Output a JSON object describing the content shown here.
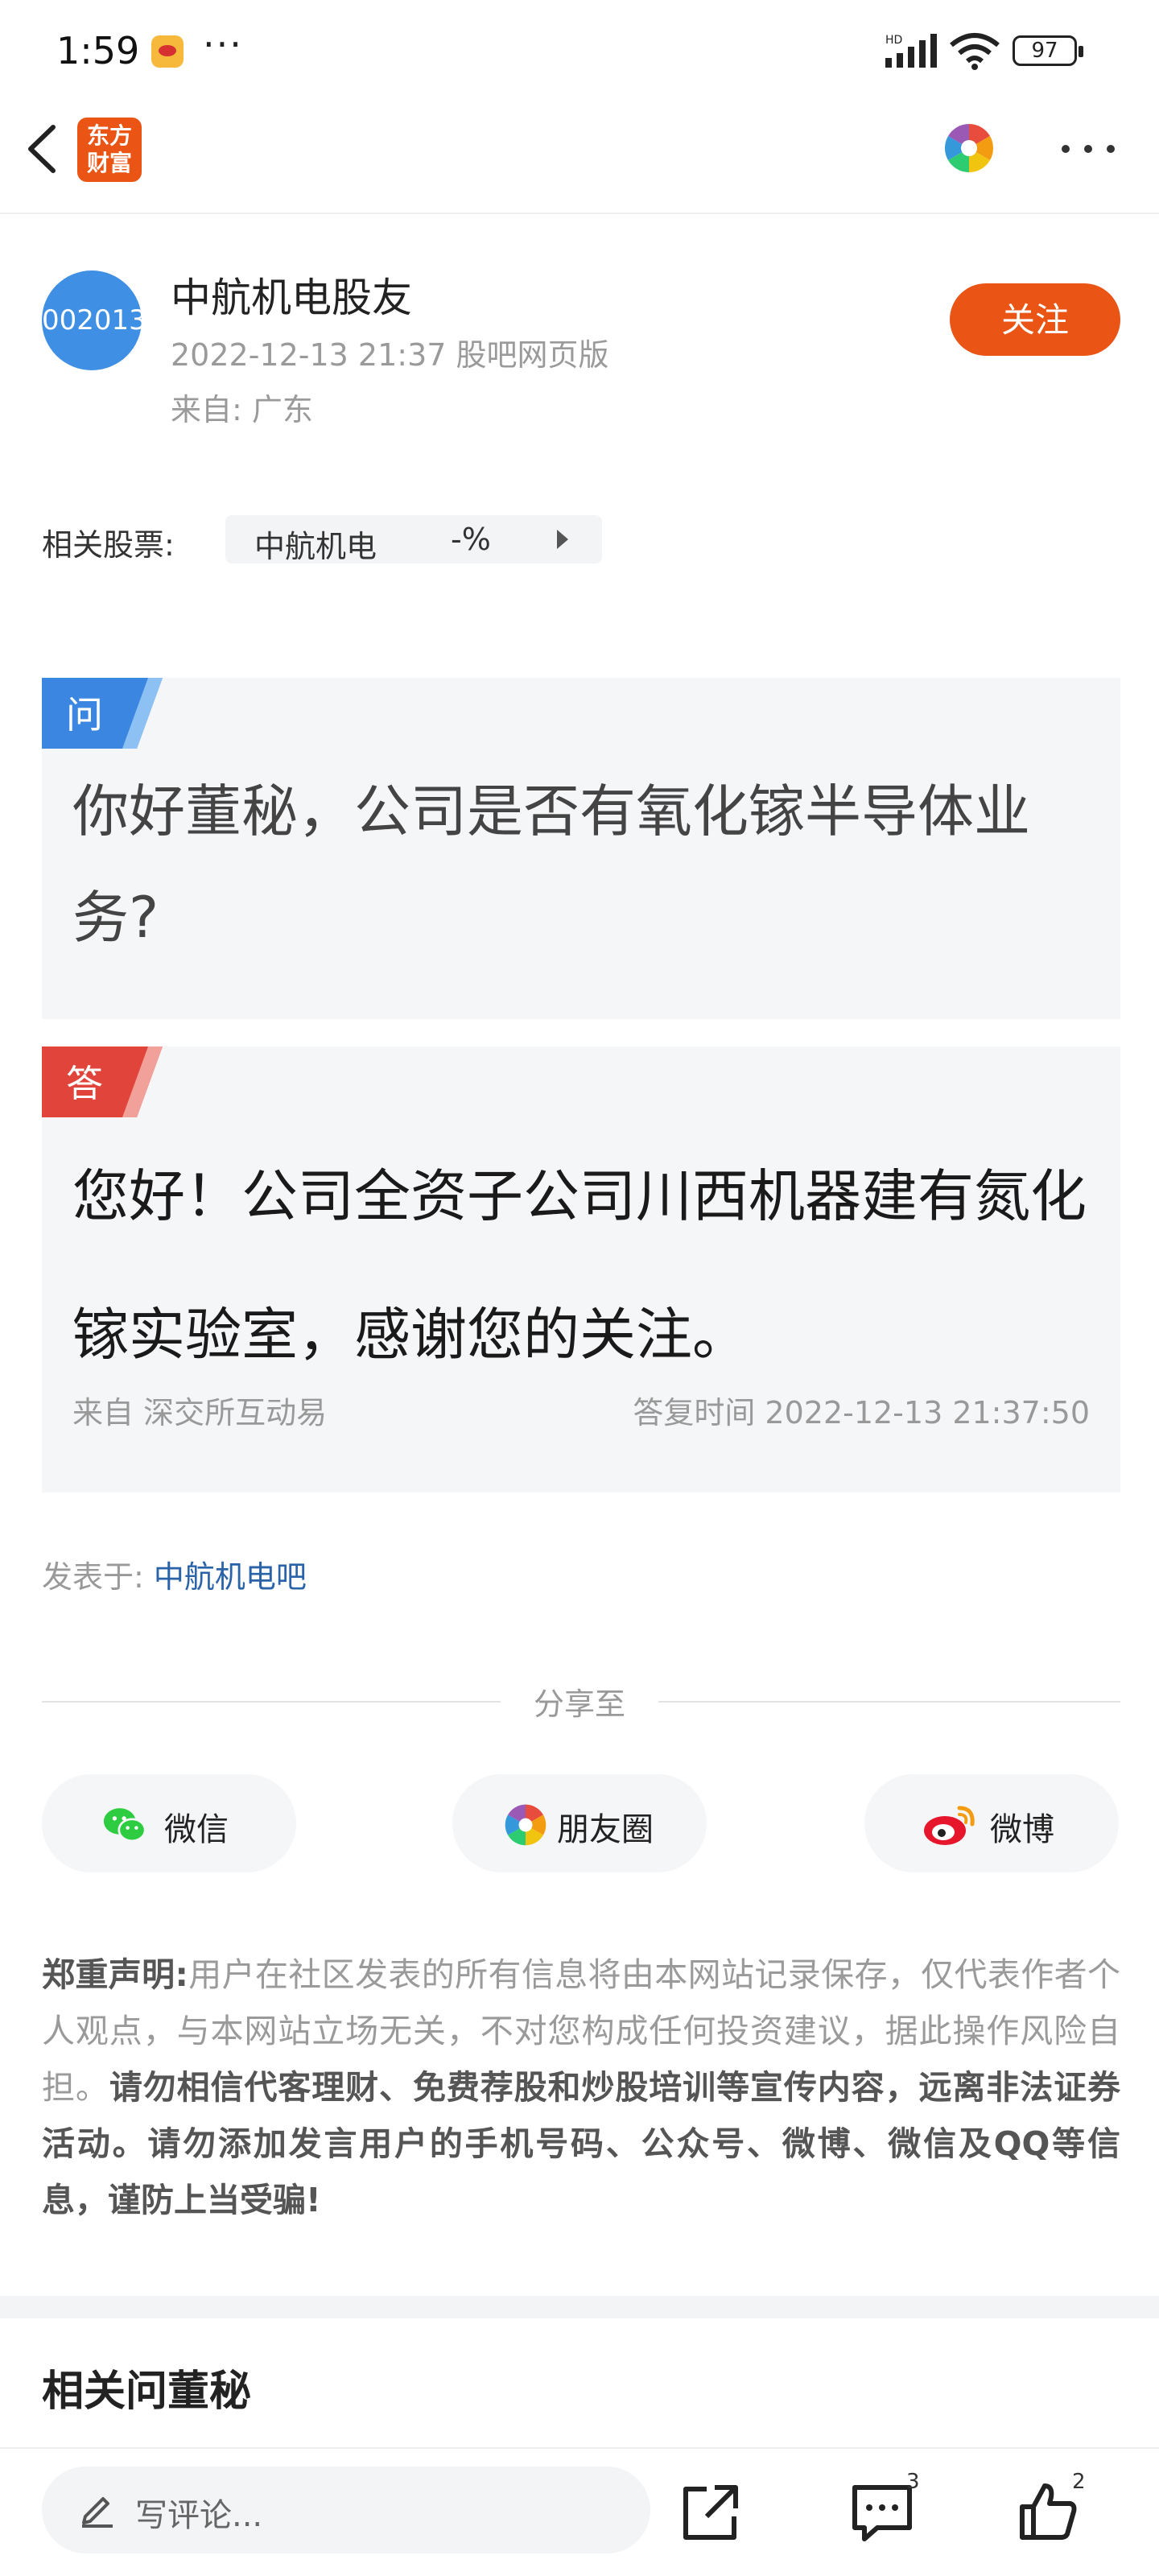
{
  "status_bar": {
    "time": "1:59",
    "dots": "···",
    "network": "HD",
    "battery": "97"
  },
  "nav": {
    "logo_line1": "东方",
    "logo_line2": "财富",
    "brand_color": "#ea5414"
  },
  "author": {
    "avatar_text": "002013",
    "name": "中航机电股友",
    "meta": "2022-12-13 21:37 股吧网页版",
    "region": "来自: 广东",
    "follow_label": "关注"
  },
  "related_stock": {
    "label": "相关股票:",
    "name": "中航机电",
    "change": "-%"
  },
  "question": {
    "tag": "问",
    "text": "你好董秘，公司是否有氧化镓半导体业务?"
  },
  "answer": {
    "tag": "答",
    "text": "您好！公司全资子公司川西机器建有氮化镓实验室，感谢您的关注。",
    "source": "来自 深交所互动易",
    "time": "答复时间 2022-12-13 21:37:50"
  },
  "posted_in": {
    "label": "发表于:",
    "bar": "中航机电吧"
  },
  "share": {
    "title": "分享至",
    "buttons": [
      {
        "label": "微信",
        "icon": "wechat-icon"
      },
      {
        "label": "朋友圈",
        "icon": "moments-icon"
      },
      {
        "label": "微博",
        "icon": "weibo-icon"
      }
    ]
  },
  "disclaimer": {
    "title": "郑重声明:",
    "body": "用户在社区发表的所有信息将由本网站记录保存，仅代表作者个人观点，与本网站立场无关，不对您构成任何投资建议，据此操作风险自担。",
    "warning": "请勿相信代客理财、免费荐股和炒股培训等宣传内容，远离非法证券活动。请勿添加发言用户的手机号码、公众号、微博、微信及QQ等信息，谨防上当受骗!"
  },
  "related_section": {
    "title": "相关问董秘"
  },
  "bottom_bar": {
    "comment_placeholder": "写评论...",
    "comment_count": "3",
    "like_count": "2"
  }
}
